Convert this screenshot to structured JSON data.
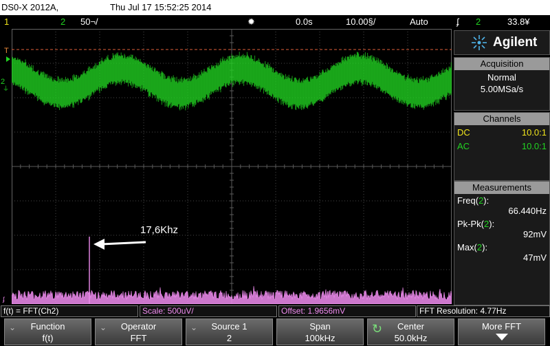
{
  "title_bar": {
    "model": "DS0-X 2012A,",
    "datetime": "Thu Jul 17 15:52:25 2014"
  },
  "status_bar": {
    "ch1_num": "1",
    "ch2_num": "2",
    "ch2_scale": "50¬/",
    "h_position": "0.0s",
    "timebase": "10.00§/",
    "trigger_mode": "Auto",
    "trigger_source": "2",
    "trigger_level": "33.8¥"
  },
  "annotation": {
    "label": "17,6Khz"
  },
  "markers": {
    "trigger_level": "T",
    "ch2_ground": "2"
  },
  "sidebar": {
    "brand": "Agilent",
    "acquisition": {
      "title": "Acquisition",
      "mode": "Normal",
      "sample_rate": "5.00MSa/s"
    },
    "channels": {
      "title": "Channels",
      "rows": [
        {
          "coupling": "DC",
          "probe": "10.0:1",
          "color": "#f2e61c"
        },
        {
          "coupling": "AC",
          "probe": "10.0:1",
          "color": "#21d321"
        }
      ]
    },
    "measurements": {
      "title": "Measurements",
      "items": [
        {
          "name": "Freq(",
          "ch": "2",
          "end": "):",
          "value": "66.440Hz"
        },
        {
          "name": "Pk-Pk(",
          "ch": "2",
          "end": "):",
          "value": "92mV"
        },
        {
          "name": "Max(",
          "ch": "2",
          "end": "):",
          "value": "47mV"
        }
      ]
    }
  },
  "info_bar": {
    "function": "f(t) = FFT(Ch2)",
    "scale": "Scale: 500uV/",
    "offset": "Offset: 1.9656mV",
    "resolution": "FFT Resolution: 4.77Hz"
  },
  "softkeys": [
    {
      "label": "Function",
      "value": "f(t)"
    },
    {
      "label": "Operator",
      "value": "FFT"
    },
    {
      "label": "Source 1",
      "value": "2"
    },
    {
      "label": "Span",
      "value": "100kHz"
    },
    {
      "label": "Center",
      "value": "50.0kHz"
    },
    {
      "label": "More FFT",
      "value": ""
    }
  ],
  "colors": {
    "ch1": "#f2e61c",
    "ch2": "#21d321",
    "math": "#f08cf0",
    "trigger_line": "#e0603a"
  }
}
